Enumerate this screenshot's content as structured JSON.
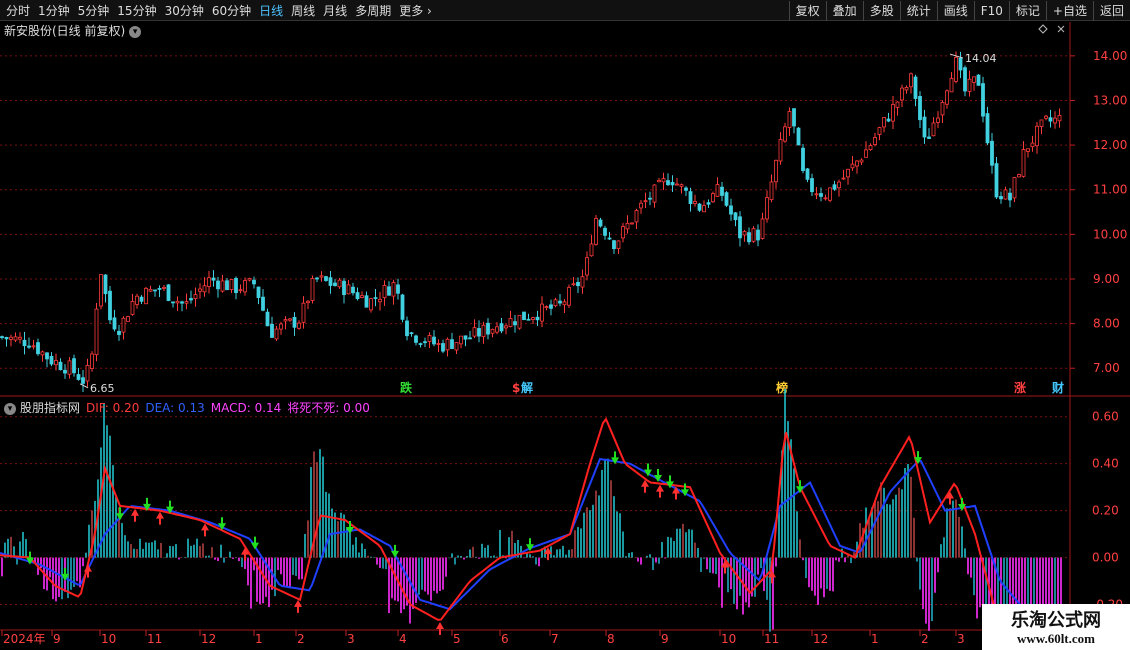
{
  "toolbar": {
    "periods": [
      "分时",
      "1分钟",
      "5分钟",
      "15分钟",
      "30分钟",
      "60分钟",
      "日线",
      "周线",
      "月线",
      "多周期",
      "更多"
    ],
    "active_period": "日线",
    "actions": [
      "复权",
      "叠加",
      "多股",
      "统计",
      "画线",
      "F10",
      "标记",
      "+自选",
      "返回"
    ]
  },
  "price_panel": {
    "title": "新安股份(日线 前复权)",
    "high_marker": "14.04",
    "low_marker": "6.65",
    "y_ticks": [
      "14.00",
      "13.00",
      "12.00",
      "11.00",
      "10.00",
      "9.00",
      "8.00",
      "7.00"
    ],
    "event_tags": [
      {
        "label": "跌",
        "color": "#33dd33"
      },
      {
        "label": "$",
        "color": "#ff4040"
      },
      {
        "label": "解",
        "color": "#44c8ff"
      },
      {
        "label": "榜",
        "color": "#ffcc33"
      },
      {
        "label": "涨",
        "color": "#ff4040"
      },
      {
        "label": "财",
        "color": "#44c8ff"
      }
    ]
  },
  "indicator_panel": {
    "name": "股朋指标网",
    "dif": "DIF: 0.20",
    "dea": "DEA: 0.13",
    "macd": "MACD: 0.14",
    "jsbs": "将死不死: 0.00",
    "y_ticks": [
      "0.60",
      "0.40",
      "0.20",
      "0.00",
      "-0.20"
    ]
  },
  "time_axis": {
    "labels": [
      "2024年",
      "9",
      "10",
      "11",
      "12",
      "1",
      "2",
      "3",
      "4",
      "5",
      "6",
      "7",
      "8",
      "9",
      "10",
      "11",
      "12",
      "1",
      "2",
      "3"
    ]
  },
  "watermark": {
    "title": "乐淘公式网",
    "url": "www.60lt.com"
  },
  "colors": {
    "up": "#ff3b3b",
    "down": "#40d0e0",
    "dif": "#ff2020",
    "dea": "#2040ff",
    "pos_bar": "#20c0c8",
    "neg_bar": "#ff30ff",
    "grid": "#7a1010"
  },
  "chart_data": {
    "type": "candlestick",
    "close_path": [
      [
        0,
        7.7
      ],
      [
        30,
        7.6
      ],
      [
        50,
        7.2
      ],
      [
        70,
        7.0
      ],
      [
        85,
        6.7
      ],
      [
        92,
        7.3
      ],
      [
        100,
        9.3
      ],
      [
        110,
        8.1
      ],
      [
        120,
        7.9
      ],
      [
        135,
        8.6
      ],
      [
        160,
        8.8
      ],
      [
        185,
        8.4
      ],
      [
        210,
        9.0
      ],
      [
        235,
        8.8
      ],
      [
        255,
        8.9
      ],
      [
        270,
        7.8
      ],
      [
        300,
        8.1
      ],
      [
        315,
        9.0
      ],
      [
        345,
        8.8
      ],
      [
        370,
        8.5
      ],
      [
        395,
        8.9
      ],
      [
        408,
        7.8
      ],
      [
        440,
        7.5
      ],
      [
        470,
        7.7
      ],
      [
        500,
        8.0
      ],
      [
        530,
        8.2
      ],
      [
        560,
        8.4
      ],
      [
        585,
        9.1
      ],
      [
        595,
        10.4
      ],
      [
        615,
        9.8
      ],
      [
        640,
        10.6
      ],
      [
        670,
        11.3
      ],
      [
        700,
        10.6
      ],
      [
        720,
        11.0
      ],
      [
        740,
        10.0
      ],
      [
        760,
        10.0
      ],
      [
        775,
        11.5
      ],
      [
        790,
        12.8
      ],
      [
        805,
        11.1
      ],
      [
        825,
        10.9
      ],
      [
        845,
        11.3
      ],
      [
        870,
        12.0
      ],
      [
        895,
        12.9
      ],
      [
        912,
        13.5
      ],
      [
        925,
        12.0
      ],
      [
        940,
        12.9
      ],
      [
        955,
        13.9
      ],
      [
        965,
        13.2
      ],
      [
        978,
        13.5
      ],
      [
        995,
        11.0
      ],
      [
        1010,
        10.8
      ],
      [
        1025,
        11.9
      ],
      [
        1045,
        12.5
      ],
      [
        1062,
        12.6
      ]
    ],
    "high": 14.04,
    "low": 6.65,
    "dif_path": [
      [
        0,
        0.01
      ],
      [
        30,
        0.0
      ],
      [
        55,
        -0.12
      ],
      [
        80,
        -0.17
      ],
      [
        95,
        0.1
      ],
      [
        105,
        0.38
      ],
      [
        120,
        0.22
      ],
      [
        160,
        0.2
      ],
      [
        200,
        0.16
      ],
      [
        240,
        0.08
      ],
      [
        270,
        -0.12
      ],
      [
        300,
        -0.18
      ],
      [
        320,
        0.18
      ],
      [
        345,
        0.16
      ],
      [
        380,
        0.05
      ],
      [
        410,
        -0.2
      ],
      [
        440,
        -0.27
      ],
      [
        470,
        -0.1
      ],
      [
        500,
        0.0
      ],
      [
        540,
        0.03
      ],
      [
        570,
        0.1
      ],
      [
        590,
        0.4
      ],
      [
        605,
        0.6
      ],
      [
        625,
        0.4
      ],
      [
        650,
        0.32
      ],
      [
        690,
        0.3
      ],
      [
        720,
        0.02
      ],
      [
        750,
        -0.15
      ],
      [
        772,
        -0.05
      ],
      [
        785,
        0.55
      ],
      [
        800,
        0.3
      ],
      [
        830,
        0.05
      ],
      [
        855,
        0.0
      ],
      [
        880,
        0.3
      ],
      [
        910,
        0.52
      ],
      [
        930,
        0.15
      ],
      [
        955,
        0.32
      ],
      [
        975,
        0.1
      ],
      [
        1000,
        -0.3
      ],
      [
        1030,
        -0.45
      ]
    ],
    "dea_path": [
      [
        0,
        0.02
      ],
      [
        40,
        -0.03
      ],
      [
        80,
        -0.12
      ],
      [
        105,
        0.1
      ],
      [
        130,
        0.22
      ],
      [
        170,
        0.2
      ],
      [
        210,
        0.15
      ],
      [
        250,
        0.08
      ],
      [
        280,
        -0.12
      ],
      [
        310,
        -0.14
      ],
      [
        330,
        0.1
      ],
      [
        360,
        0.12
      ],
      [
        390,
        0.05
      ],
      [
        420,
        -0.18
      ],
      [
        450,
        -0.22
      ],
      [
        490,
        -0.05
      ],
      [
        530,
        0.04
      ],
      [
        570,
        0.1
      ],
      [
        600,
        0.42
      ],
      [
        630,
        0.4
      ],
      [
        660,
        0.33
      ],
      [
        700,
        0.24
      ],
      [
        730,
        0.02
      ],
      [
        760,
        -0.1
      ],
      [
        780,
        0.22
      ],
      [
        810,
        0.32
      ],
      [
        840,
        0.05
      ],
      [
        860,
        0.02
      ],
      [
        890,
        0.28
      ],
      [
        920,
        0.42
      ],
      [
        945,
        0.2
      ],
      [
        975,
        0.22
      ],
      [
        1000,
        -0.1
      ],
      [
        1040,
        -0.3
      ]
    ],
    "macd_y_range": [
      -0.3,
      0.65
    ],
    "price_y_range": [
      6.4,
      14.4
    ]
  }
}
